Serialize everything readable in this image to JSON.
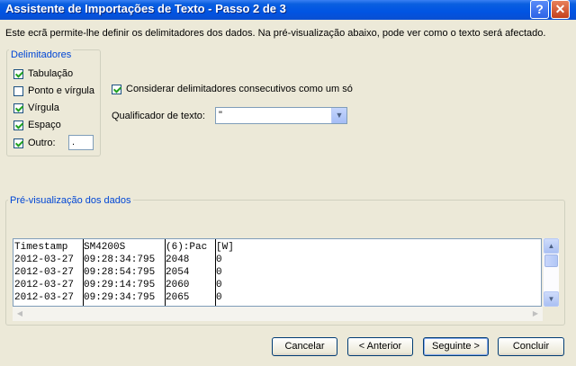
{
  "window": {
    "title": "Assistente de Importações de Texto - Passo 2 de 3",
    "help_glyph": "?",
    "close_glyph": "✕"
  },
  "description": "Este ecrã permite-lhe definir os delimitadores dos dados. Na pré-visualização abaixo, pode ver como o texto será afectado.",
  "delimiters": {
    "legend": "Delimitadores",
    "items": [
      {
        "label": "Tabulação",
        "checked": true
      },
      {
        "label": "Ponto e vírgula",
        "checked": false
      },
      {
        "label": "Vírgula",
        "checked": true
      },
      {
        "label": "Espaço",
        "checked": true
      },
      {
        "label": "Outro:",
        "checked": true
      }
    ],
    "other_value": "."
  },
  "consecutive": {
    "label": "Considerar delimitadores consecutivos como um só",
    "checked": true
  },
  "qualifier": {
    "label": "Qualificador de texto:",
    "value": "\""
  },
  "preview": {
    "legend": "Pré-visualização dos dados",
    "rows": [
      [
        "Timestamp",
        "SM4200S",
        "(6):Pac",
        "[W]"
      ],
      [
        "2012-03-27",
        "09:28:34:795",
        "2048",
        "0"
      ],
      [
        "2012-03-27",
        "09:28:54:795",
        "2054",
        "0"
      ],
      [
        "2012-03-27",
        "09:29:14:795",
        "2060",
        "0"
      ],
      [
        "2012-03-27",
        "09:29:34:795",
        "2065",
        "0"
      ]
    ]
  },
  "buttons": {
    "cancel": "Cancelar",
    "back": "< Anterior",
    "next": "Seguinte >",
    "finish": "Concluir"
  }
}
